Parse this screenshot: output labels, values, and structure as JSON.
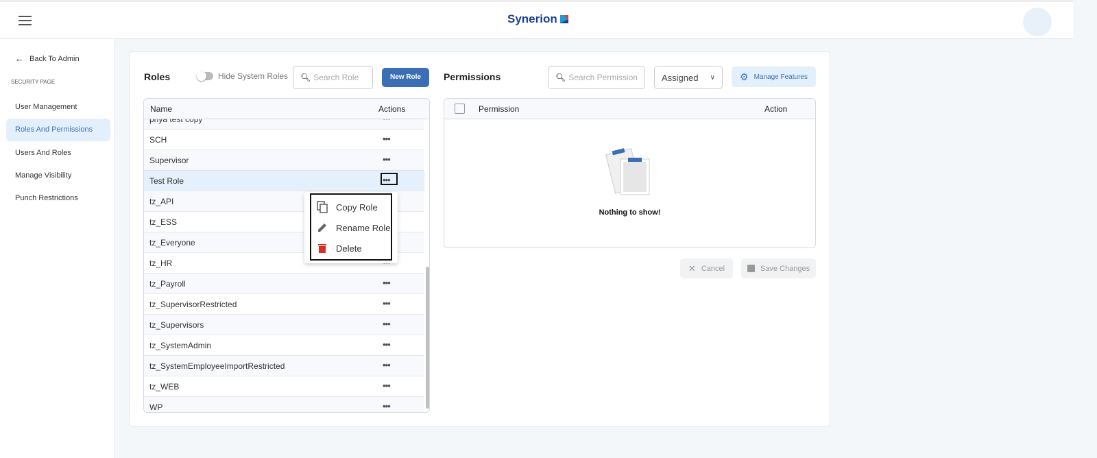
{
  "header": {
    "logo_text": "Synerion",
    "brand_color": "#1b3f8b"
  },
  "sidebar": {
    "back_label": "Back To Admin",
    "section": "SECURITY PAGE",
    "items": [
      {
        "label": "User Management",
        "active": false
      },
      {
        "label": "Roles And Permissions",
        "active": true
      },
      {
        "label": "Users And Roles",
        "active": false
      },
      {
        "label": "Manage Visibility",
        "active": false
      },
      {
        "label": "Punch Restrictions",
        "active": false
      }
    ]
  },
  "roles": {
    "title": "Roles",
    "toggle_label": "Hide System Roles",
    "toggle_on": false,
    "search_placeholder": "Search Role",
    "new_button": "New Role",
    "columns": [
      "Name",
      "Actions"
    ],
    "rows": [
      "priya test copy",
      "SCH",
      "Supervisor",
      "Test Role",
      "tz_API",
      "tz_ESS",
      "tz_Everyone",
      "tz_HR",
      "tz_Payroll",
      "tz_SupervisorRestricted",
      "tz_Supervisors",
      "tz_SystemAdmin",
      "tz_SystemEmployeeImportRestricted",
      "tz_WEB",
      "WP"
    ],
    "selected": "Test Role",
    "actions_glyph": "•••",
    "menu": [
      {
        "label": "Copy Role",
        "icon": "copy-icon"
      },
      {
        "label": "Rename Role",
        "icon": "pencil-icon"
      },
      {
        "label": "Delete",
        "icon": "trash-icon"
      }
    ]
  },
  "permissions": {
    "title": "Permissions",
    "search_placeholder": "Search Permission",
    "filter_value": "Assigned",
    "manage_button": "Manage Features",
    "columns": [
      "Permission",
      "Action"
    ],
    "empty_text": "Nothing to show!",
    "cancel": "Cancel",
    "save": "Save Changes"
  },
  "colors": {
    "accent": "#3a6eb5",
    "delete": "#d93025"
  }
}
